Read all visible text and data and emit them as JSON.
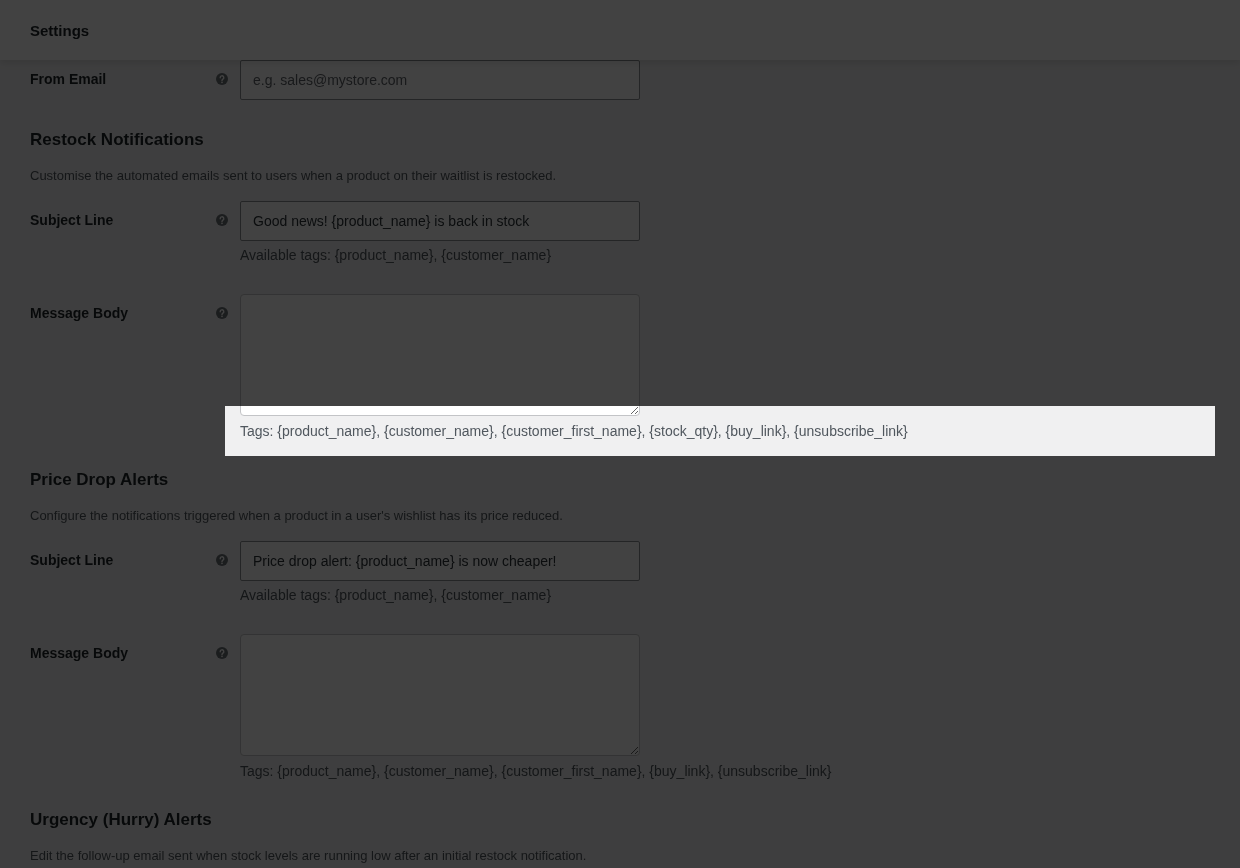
{
  "header": {
    "title": "Settings"
  },
  "sections": [
    {
      "fields": [
        {
          "kind": "input",
          "label": "From Email",
          "placeholder": "e.g. sales@mystore.com",
          "highlighted": false
        }
      ]
    },
    {
      "title": "Restock Notifications",
      "description": "Customise the automated emails sent to users when a product on their waitlist is restocked.",
      "fields": [
        {
          "kind": "input",
          "label": "Subject Line",
          "value": "Good news! {product_name} is back in stock",
          "hint": "Available tags: {product_name}, {customer_name}",
          "highlighted": false
        },
        {
          "kind": "textarea",
          "label": "Message Body",
          "hint": "Tags: {product_name}, {customer_name}, {customer_first_name}, {stock_qty}, {buy_link}, {unsubscribe_link}",
          "highlighted": true
        }
      ]
    },
    {
      "title": "Price Drop Alerts",
      "description": "Configure the notifications triggered when a product in a user's wishlist has its price reduced.",
      "fields": [
        {
          "kind": "input",
          "label": "Subject Line",
          "value": "Price drop alert: {product_name} is now cheaper!",
          "hint": "Available tags: {product_name}, {customer_name}",
          "highlighted": false
        },
        {
          "kind": "textarea",
          "label": "Message Body",
          "hint": "Tags: {product_name}, {customer_name}, {customer_first_name}, {buy_link}, {unsubscribe_link}",
          "highlighted": false
        }
      ]
    },
    {
      "title": "Urgency (Hurry) Alerts",
      "description": "Edit the follow-up email sent when stock levels are running low after an initial restock notification."
    }
  ]
}
